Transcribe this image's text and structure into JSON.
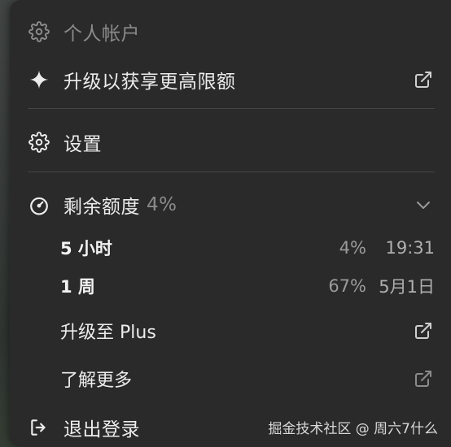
{
  "menu": {
    "personal_account": "个人帐户",
    "upgrade_limit": "升级以获享更高限额",
    "settings": "设置",
    "remaining_quota": "剩余额度",
    "remaining_percent": "4%",
    "usage": [
      {
        "name": "5 小时",
        "percent": "4%",
        "reset": "19:31"
      },
      {
        "name": "1 周",
        "percent": "67%",
        "reset": "5月1日"
      }
    ],
    "upgrade_plus": "升级至 Plus",
    "learn_more": "了解更多",
    "logout": "退出登录"
  },
  "watermark": "掘金技术社区 @ 周六7什么",
  "icons": {
    "personal_account": "gear-icon",
    "upgrade_limit": "sparkle-icon",
    "settings": "gear-icon",
    "remaining_quota": "gauge-icon",
    "logout": "logout-icon",
    "external": "external-link-icon",
    "expand": "chevron-down-icon"
  },
  "colors": {
    "menu_bg": "#2a2a2a",
    "text": "#ececec",
    "dim_text": "#8b8b8b",
    "divider": "#454545"
  }
}
